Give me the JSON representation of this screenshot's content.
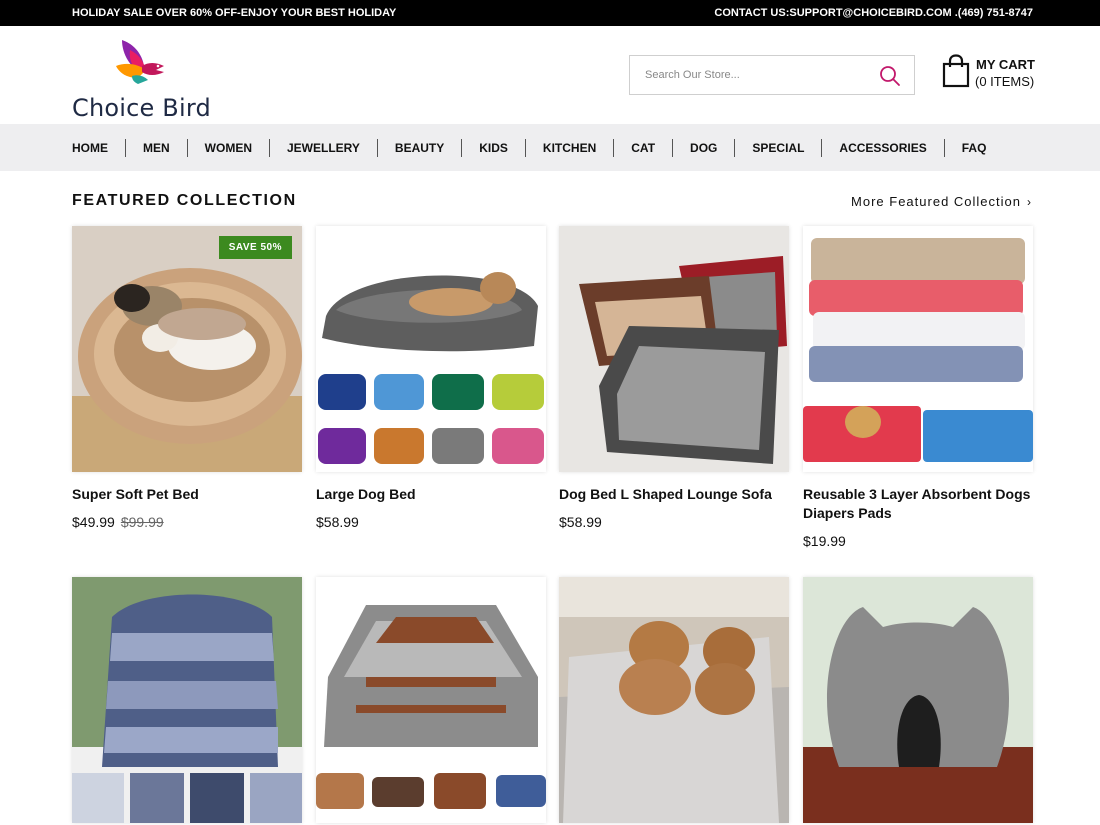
{
  "topbar": {
    "promo": "HOLIDAY SALE OVER 60% OFF-ENJOY YOUR BEST HOLIDAY",
    "contact": "CONTACT US:SUPPORT@CHOICEBIRD.COM .(469) 751-8747"
  },
  "header": {
    "logo_text": "Choice Bird",
    "search_placeholder": "Search Our Store...",
    "cart_title": "MY CART",
    "cart_items": "(0 ITEMS)"
  },
  "nav": {
    "items": [
      "HOME",
      "MEN",
      "WOMEN",
      "JEWELLERY",
      "BEAUTY",
      "KIDS",
      "KITCHEN",
      "CAT",
      "DOG",
      "SPECIAL",
      "ACCESSORIES",
      "FAQ"
    ]
  },
  "featured": {
    "title": "FEATURED COLLECTION",
    "more_label": "More Featured Collection",
    "more_icon": "chevron-right-icon",
    "products": [
      {
        "name": "Super Soft Pet Bed",
        "price": "$49.99",
        "compare_price": "$99.99",
        "badge": "SAVE 50%"
      },
      {
        "name": "Large Dog Bed",
        "price": "$58.99"
      },
      {
        "name": "Dog Bed L Shaped Lounge Sofa",
        "price": "$58.99"
      },
      {
        "name": "Reusable 3 Layer Absorbent Dogs Diapers Pads",
        "price": "$19.99"
      },
      {
        "name": "",
        "price": ""
      },
      {
        "name": "",
        "price": ""
      },
      {
        "name": "",
        "price": ""
      },
      {
        "name": "",
        "price": ""
      }
    ]
  },
  "colors": {
    "topbar_bg": "#000000",
    "nav_bg": "#eeeef0",
    "badge_bg": "#3c8a1f",
    "search_icon": "#c2186b"
  }
}
